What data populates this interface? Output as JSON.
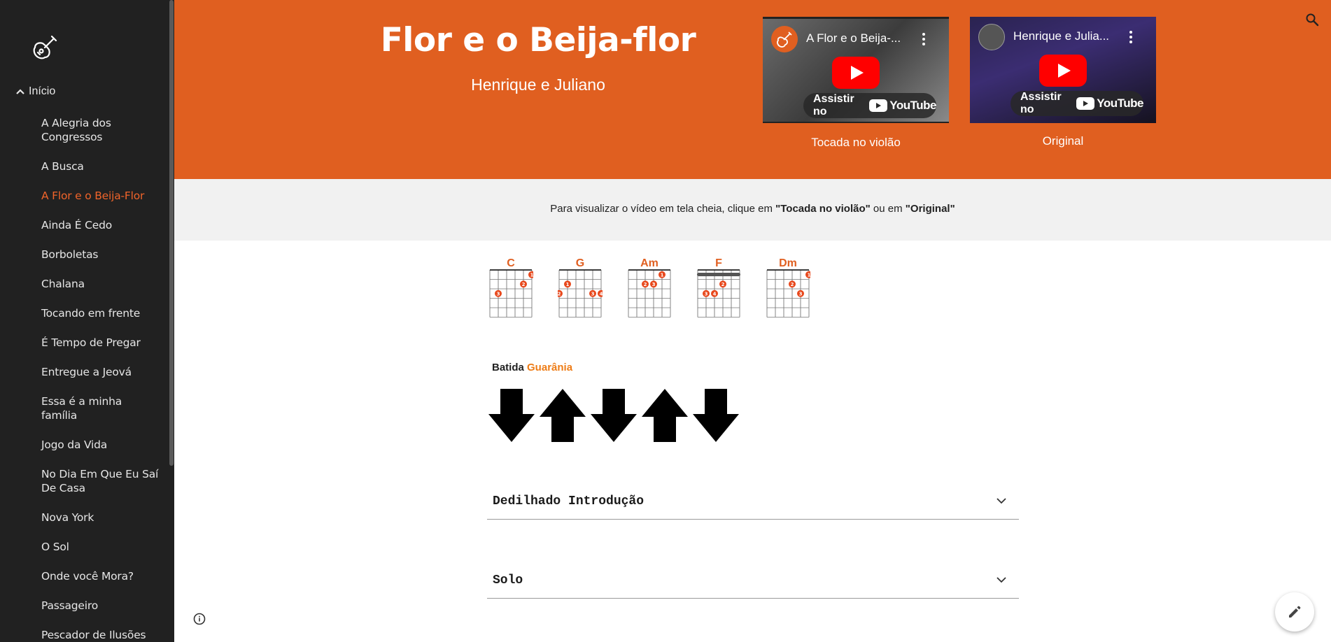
{
  "sidebar": {
    "home_label": "Início",
    "items": [
      {
        "label": "A Alegria dos Congressos",
        "active": false
      },
      {
        "label": "A Busca",
        "active": false
      },
      {
        "label": "A Flor e o Beija-Flor",
        "active": true
      },
      {
        "label": "Ainda É Cedo",
        "active": false
      },
      {
        "label": "Borboletas",
        "active": false
      },
      {
        "label": "Chalana",
        "active": false
      },
      {
        "label": "Tocando em frente",
        "active": false
      },
      {
        "label": "É Tempo de Pregar",
        "active": false
      },
      {
        "label": "Entregue a Jeová",
        "active": false
      },
      {
        "label": "Essa é a minha família",
        "active": false
      },
      {
        "label": "Jogo da Vida",
        "active": false
      },
      {
        "label": "No Dia Em Que Eu Saí De Casa",
        "active": false
      },
      {
        "label": "Nova York",
        "active": false
      },
      {
        "label": "O Sol",
        "active": false
      },
      {
        "label": "Onde você Mora?",
        "active": false
      },
      {
        "label": "Passageiro",
        "active": false
      },
      {
        "label": "Pescador de Ilusões",
        "active": false
      }
    ]
  },
  "header": {
    "title": "Flor e o Beija-flor",
    "artist": "Henrique e Juliano",
    "videos": [
      {
        "title": "A Flor e o Beija-...",
        "watch": "Assistir no",
        "brand": "YouTube",
        "caption": "Tocada no violão"
      },
      {
        "title": "Henrique e Julia...",
        "watch": "Assistir no",
        "brand": "YouTube",
        "caption": "Original"
      }
    ]
  },
  "band": {
    "text_before": "Para visualizar o vídeo em tela cheia, clique em ",
    "strong1": "\"Tocada no violão\"",
    "text_middle": " ou em ",
    "strong2": "\"Original\""
  },
  "chords": [
    {
      "name": "C",
      "barre": false,
      "dots": [
        {
          "s": 5,
          "f": 1,
          "n": "1"
        },
        {
          "s": 4,
          "f": 2,
          "n": "2"
        },
        {
          "s": 1,
          "f": 3,
          "n": "3"
        }
      ]
    },
    {
      "name": "G",
      "barre": false,
      "dots": [
        {
          "s": 1,
          "f": 2,
          "n": "1"
        },
        {
          "s": 0,
          "f": 3,
          "n": "2"
        },
        {
          "s": 4,
          "f": 3,
          "n": "3"
        },
        {
          "s": 5,
          "f": 3,
          "n": "4"
        }
      ]
    },
    {
      "name": "Am",
      "barre": false,
      "dots": [
        {
          "s": 4,
          "f": 1,
          "n": "1"
        },
        {
          "s": 2,
          "f": 2,
          "n": "2"
        },
        {
          "s": 3,
          "f": 2,
          "n": "3"
        }
      ]
    },
    {
      "name": "F",
      "barre": true,
      "dots": [
        {
          "s": 3,
          "f": 2,
          "n": "2"
        },
        {
          "s": 1,
          "f": 3,
          "n": "3"
        },
        {
          "s": 2,
          "f": 3,
          "n": "4"
        }
      ]
    },
    {
      "name": "Dm",
      "barre": false,
      "dots": [
        {
          "s": 5,
          "f": 1,
          "n": "1"
        },
        {
          "s": 3,
          "f": 2,
          "n": "2"
        },
        {
          "s": 4,
          "f": 3,
          "n": "3"
        }
      ]
    }
  ],
  "strum": {
    "label": "Batida",
    "style": "Guarânia",
    "pattern": [
      "down",
      "up",
      "down",
      "up",
      "down"
    ]
  },
  "accordions": [
    {
      "label": "Dedilhado Introdução"
    },
    {
      "label": "Solo"
    }
  ],
  "colors": {
    "accent": "#e05f20",
    "sidebar_bg": "#212121",
    "active_link": "#f0642a",
    "batida_style": "#ee7c16"
  }
}
